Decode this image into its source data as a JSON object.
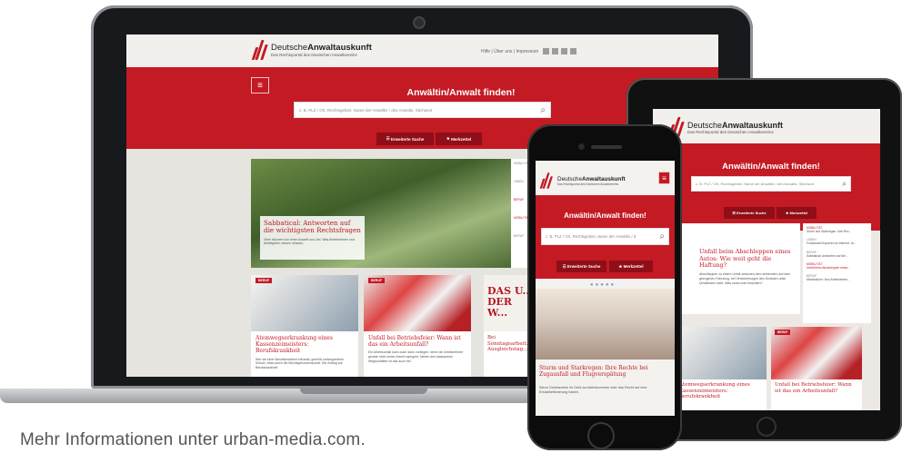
{
  "caption": "Mehr Informationen unter urban-media.com.",
  "site": {
    "logo_light": "Deutsche",
    "logo_bold": "Anwaltauskunft",
    "logo_sub": "Das Rechtsportal des Deutschen Anwaltvereins",
    "nav": [
      "Hilfe",
      "Über uns",
      "Impressum"
    ],
    "headline": "Anwältin/Anwalt finden!",
    "search_placeholder": "z. B. PLZ / Ort, Rechtsgebiet, Name der Anwältin / des Anwalts, Stichwort",
    "search_placeholder_short": "z. B. PLZ / Ort, Rechtsgebiet, Name der Anwältin / d",
    "btn_advanced": "Erweiterte Suche",
    "btn_watchlist": "Merkzettel",
    "feature_title": "Sabbatical: Antworten auf die wichtigsten Rechtsfragen",
    "feature_text": "Viele träumen von einer Auszeit von Job. Was Arbeitnehmer und Arbeitgeber wissen müssen.",
    "side_items": [
      {
        "tag": "MOBILITÄT",
        "text": "Sturm und Starkregen: Ihre Rec..."
      },
      {
        "tag": "LEBEN",
        "text": "Fotoklauen/Kopieren im Internet: Ur..."
      },
      {
        "tag": "BERUF",
        "text": "Sabbatical: Antworten auf die ..."
      },
      {
        "tag": "MOBILITÄT",
        "text": "Unfall beim Abschleppen eines..."
      },
      {
        "tag": "BERUF",
        "text": "Mindestlohn: Neu Arbeitnehme..."
      }
    ],
    "tag_beruf": "BERUF",
    "card1_title": "Atemwegserkrankung eines Kassenzeimeisters: Berufskrankheit",
    "card1_text": "Wer sie einer Berufskrankheit erkrankt, genießt umfangreichen Schutz, etwa durch die Berufsgenossenschaft. Der Antrag auf Berufskrankheit",
    "card2_title": "Unfall bei Betriebsfeier: Wann ist das ein Arbeitsunfall?",
    "card2_text": "Ein Arbeitsunfall kann auch dann vorliegen, wenn der Arbeitnehmer gerade nicht seiner Arbeit nachgeht. Neben den klassischen Wegeunfällen ist das auch bei",
    "card3_title": "Bei Sonntagsarbeit... Ausgleichstag...",
    "card3_img": "DAS U... DER W...",
    "tablet_feature_title": "Unfall beim Abschleppen eines Autos: Wie weit geht die Haftung?",
    "tablet_feature_text": "Abschleppen zu einem Unfall zwischen dem ziehenden und dem gezogenen Fahrzeug, bei Versicherungen den Schaden unter Umständen nicht. Was muss man beachten?",
    "phone_feature_title": "Sturm und Starkregen: Ihre Rechte bei Zugausfall und Flugverspätung",
    "phone_feature_text": "Wenn Gestrandete ihr Geld zurückbekommen oder das Recht auf eine Ersatzbeförderung haben."
  },
  "colors": {
    "brand_red": "#c31a24",
    "dark_red": "#8f0e17",
    "bg": "#e6e4df"
  },
  "icons": [
    "menu-icon",
    "search-icon",
    "filter-icon",
    "star-icon",
    "logo-mark-icon"
  ]
}
